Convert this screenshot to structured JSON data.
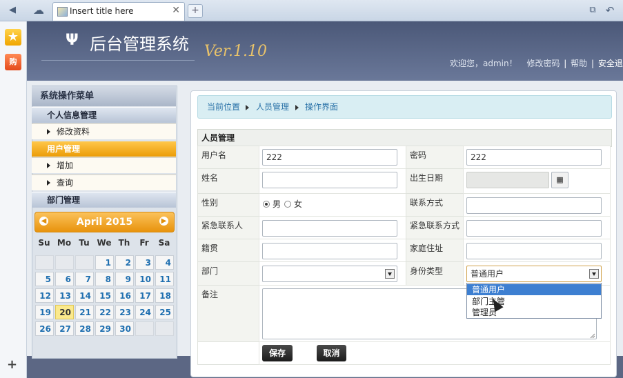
{
  "browser": {
    "tab_title": "Insert title here",
    "tab_close": "✕",
    "new_tab": "+",
    "back_glyph": "◀",
    "cloud_glyph": "☁",
    "restore_glyph": "⧉",
    "undo_glyph": "↶",
    "rail_star": "★",
    "rail_shop": "购",
    "rail_add": "+"
  },
  "header": {
    "logo_glyph": "Ψ",
    "title": "后台管理系统",
    "version": "Ver.1.10",
    "welcome": "欢迎您，admin！",
    "change_pwd": "修改密码",
    "sep1": "|",
    "help": "帮助",
    "sep2": "|",
    "logout": "安全退出"
  },
  "sidebar": {
    "title": "系统操作菜单",
    "group1": "个人信息管理",
    "item_edit": "修改资料",
    "active": "用户管理",
    "item_add": "增加",
    "item_query": "查询",
    "group2": "部门管理"
  },
  "calendar": {
    "month": "April 2015",
    "prev": "◀",
    "next": "▶",
    "weekdays": [
      "Su",
      "Mo",
      "Tu",
      "We",
      "Th",
      "Fr",
      "Sa"
    ],
    "days": [
      "",
      "",
      "",
      "1",
      "2",
      "3",
      "4",
      "5",
      "6",
      "7",
      "8",
      "9",
      "10",
      "11",
      "12",
      "13",
      "14",
      "15",
      "16",
      "17",
      "18",
      "19",
      "20",
      "21",
      "22",
      "23",
      "24",
      "25",
      "26",
      "27",
      "28",
      "29",
      "30"
    ],
    "today": "20"
  },
  "breadcrumb": {
    "current": "当前位置",
    "level1": "人员管理",
    "level2": "操作界面"
  },
  "form": {
    "title": "人员管理",
    "username_label": "用户名",
    "username_value": "222",
    "password_label": "密码",
    "password_value": "222",
    "name_label": "姓名",
    "birth_label": "出生日期",
    "calendar_btn": "▦",
    "gender_label": "性别",
    "gender_male": "男",
    "gender_female": "女",
    "contact_label": "联系方式",
    "emergency_label": "紧急联系人",
    "emergency_contact_label": "紧急联系方式",
    "origin_label": "籍贯",
    "address_label": "家庭住址",
    "dept_label": "部门",
    "role_label": "身份类型",
    "role_value": "普通用户",
    "role_options": [
      "普通用户",
      "部门主管",
      "管理员"
    ],
    "remark_label": "备注",
    "save_button": "保存",
    "cancel_button": "取消"
  }
}
